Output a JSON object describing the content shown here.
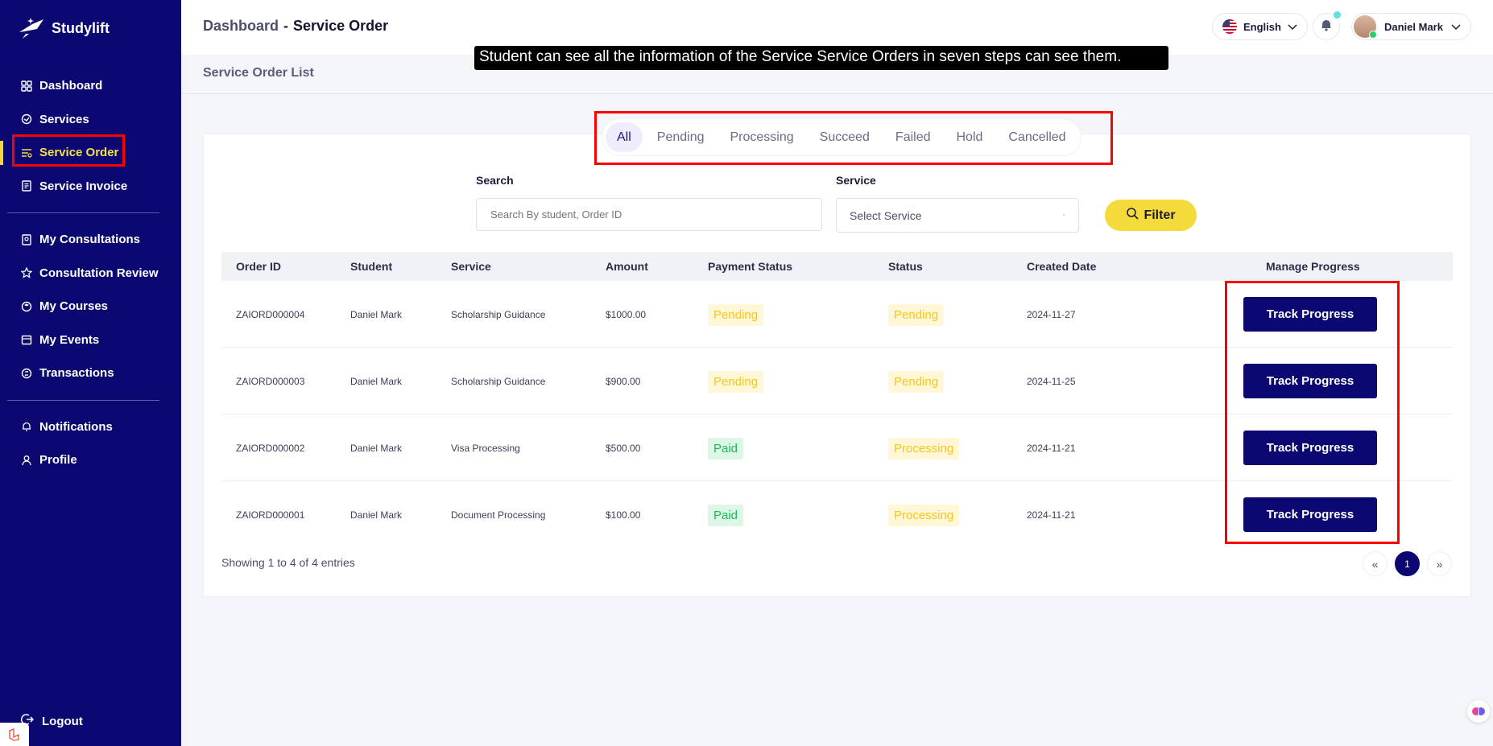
{
  "app": {
    "brand": "Studylift"
  },
  "sidebar": {
    "items": [
      {
        "label": "Dashboard",
        "icon": "dashboard-icon"
      },
      {
        "label": "Services",
        "icon": "services-icon"
      },
      {
        "label": "Service Order",
        "icon": "list-icon",
        "active": true
      },
      {
        "label": "Service Invoice",
        "icon": "invoice-icon"
      }
    ],
    "items2": [
      {
        "label": "My Consultations",
        "icon": "consultation-icon"
      },
      {
        "label": "Consultation Review",
        "icon": "star-icon"
      },
      {
        "label": "My Courses",
        "icon": "courses-icon"
      },
      {
        "label": "My Events",
        "icon": "calendar-icon"
      },
      {
        "label": "Transactions",
        "icon": "transactions-icon"
      }
    ],
    "items3": [
      {
        "label": "Notifications",
        "icon": "bell-icon"
      },
      {
        "label": "Profile",
        "icon": "user-icon"
      }
    ],
    "logout": "Logout"
  },
  "header": {
    "breadcrumb_home": "Dashboard",
    "breadcrumb_sep": "-",
    "breadcrumb_current": "Service Order",
    "language": "English",
    "user_name": "Daniel Mark"
  },
  "page": {
    "title": "Service Order List"
  },
  "tooltip": "Student can see all the information of the Service Service Orders in seven steps can see them.",
  "tabs": [
    "All",
    "Pending",
    "Processing",
    "Succeed",
    "Failed",
    "Hold",
    "Cancelled"
  ],
  "filters": {
    "search_label": "Search",
    "search_placeholder": "Search By student, Order ID",
    "service_label": "Service",
    "service_value": "Select Service",
    "filter_button": "Filter"
  },
  "table": {
    "columns": [
      "Order ID",
      "Student",
      "Service",
      "Amount",
      "Payment Status",
      "Status",
      "Created Date",
      "Manage Progress"
    ],
    "rows": [
      {
        "order_id": "ZAIORD000004",
        "student": "Daniel Mark",
        "service": "Scholarship Guidance",
        "amount": "$1000.00",
        "payment_status": "Pending",
        "status": "Pending",
        "created": "2024-11-27",
        "action": "Track Progress"
      },
      {
        "order_id": "ZAIORD000003",
        "student": "Daniel Mark",
        "service": "Scholarship Guidance",
        "amount": "$900.00",
        "payment_status": "Pending",
        "status": "Pending",
        "created": "2024-11-25",
        "action": "Track Progress"
      },
      {
        "order_id": "ZAIORD000002",
        "student": "Daniel Mark",
        "service": "Visa Processing",
        "amount": "$500.00",
        "payment_status": "Paid",
        "status": "Processing",
        "created": "2024-11-21",
        "action": "Track Progress"
      },
      {
        "order_id": "ZAIORD000001",
        "student": "Daniel Mark",
        "service": "Document Processing",
        "amount": "$100.00",
        "payment_status": "Paid",
        "status": "Processing",
        "created": "2024-11-21",
        "action": "Track Progress"
      }
    ]
  },
  "pagination": {
    "info": "Showing 1 to 4 of 4 entries",
    "prev": "«",
    "page": "1",
    "next": "»"
  },
  "colors": {
    "sidebar": "#0b0872",
    "accent": "#f4da3b",
    "highlight": "#ff0000"
  }
}
